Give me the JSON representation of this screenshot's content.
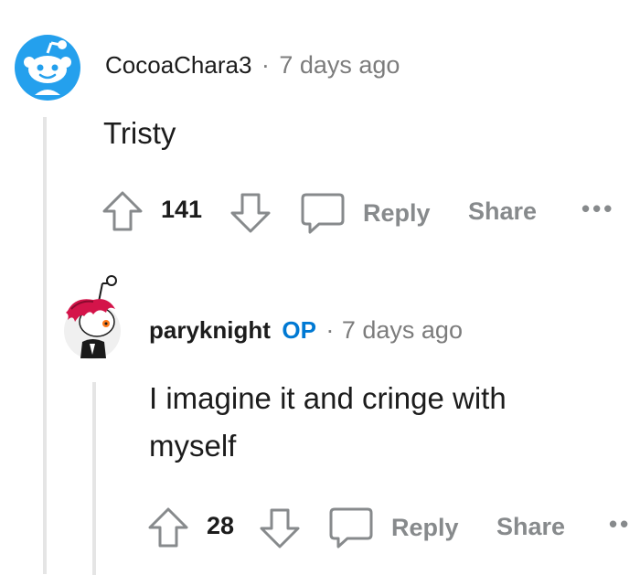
{
  "comments": [
    {
      "username": "CocoaChara3",
      "separator": "·",
      "timestamp": "7 days ago",
      "body": "Tristy",
      "votes": "141",
      "reply_label": "Reply",
      "share_label": "Share",
      "more_label": "•••",
      "avatar_icon": "snoo-default-avatar-icon"
    },
    {
      "username": "paryknight",
      "op_badge": "OP",
      "separator": "·",
      "timestamp": "7 days ago",
      "body_line1": "I imagine it and cringe with",
      "body_line2": "myself",
      "votes": "28",
      "reply_label": "Reply",
      "share_label": "Share",
      "more_label": "••",
      "avatar_icon": "snoo-custom-avatar-icon"
    }
  ],
  "colors": {
    "text": "#1c1c1c",
    "meta": "#7c7c7c",
    "action": "#878a8c",
    "op": "#0079d3",
    "avatar_blue": "#24a0ed",
    "thread_line": "#e5e5e5"
  }
}
